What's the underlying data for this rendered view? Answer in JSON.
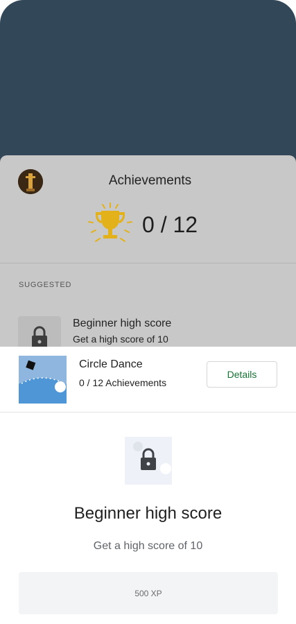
{
  "achievements_sheet": {
    "title": "Achievements",
    "count": "0 / 12",
    "section_label": "SUGGESTED",
    "suggested_item": {
      "title": "Beginner high score",
      "subtitle": "Get a high score of 10"
    }
  },
  "game": {
    "title": "Circle Dance",
    "subtitle": "0 / 12 Achievements",
    "details_label": "Details"
  },
  "achievement_detail": {
    "title": "Beginner high score",
    "description": "Get a high score of 10",
    "xp": "500 XP"
  },
  "colors": {
    "top_area": "#324757",
    "details_text": "#137333",
    "trophy_gold": "#e3b21b"
  }
}
